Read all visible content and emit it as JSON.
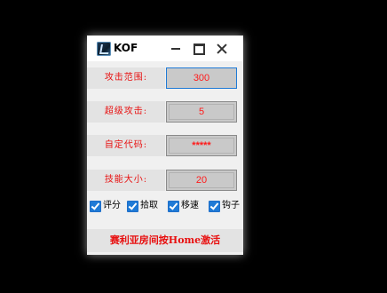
{
  "window": {
    "title": "KOF",
    "icon": "app-icon"
  },
  "colors": {
    "label_text": "#e81010",
    "input_text": "#ff1a1a",
    "input_bg": "#c9c9c9",
    "checkbox": "#1f7ad6",
    "background": "#000000"
  },
  "fields": [
    {
      "label": "攻击范围:",
      "value": "300"
    },
    {
      "label": "超级攻击:",
      "value": "5"
    },
    {
      "label": "自定代码:",
      "value": "*****"
    },
    {
      "label": "技能大小:",
      "value": "20"
    }
  ],
  "checkboxes": [
    {
      "label": "评分",
      "checked": true
    },
    {
      "label": "拾取",
      "checked": true
    },
    {
      "label": "移速",
      "checked": true
    },
    {
      "label": "钩子",
      "checked": true
    }
  ],
  "banner": {
    "text": "赛利亚房间按Home激活"
  }
}
